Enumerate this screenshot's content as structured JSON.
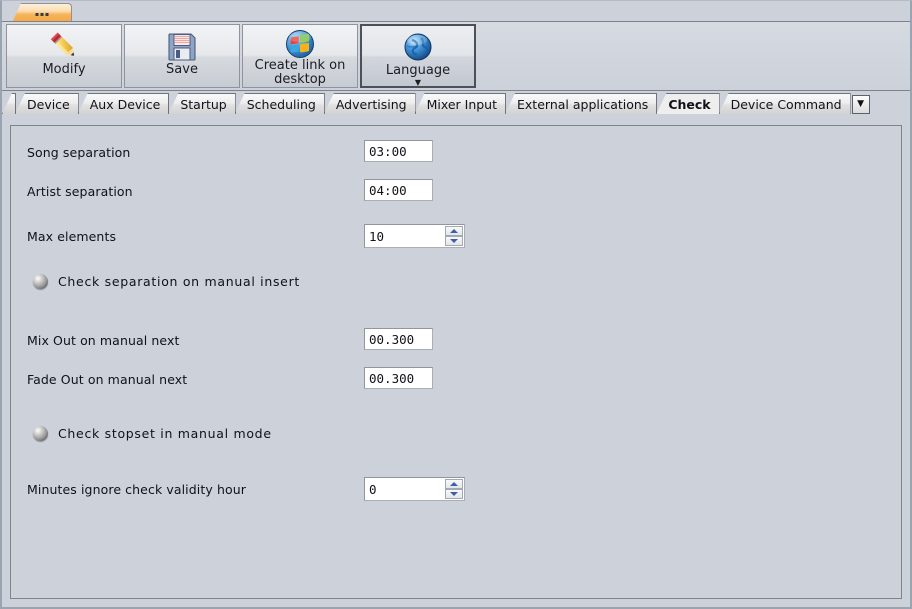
{
  "window": {
    "folder_tab": {
      "name": "overflow-dots",
      "label": "..."
    }
  },
  "toolbar": {
    "buttons": [
      {
        "id": "modify",
        "label": "Modify",
        "icon": "pencil-icon",
        "selected": false,
        "has_caret": false
      },
      {
        "id": "save",
        "label": "Save",
        "icon": "floppy-disk-icon",
        "selected": false,
        "has_caret": false
      },
      {
        "id": "shortcut",
        "label": "Create link on desktop",
        "icon": "windows-logo-icon",
        "selected": false,
        "has_caret": false
      },
      {
        "id": "language",
        "label": "Language",
        "icon": "globe-icon",
        "selected": true,
        "has_caret": true,
        "caret": "▼"
      }
    ]
  },
  "tabs": {
    "items": [
      {
        "label": "",
        "active": false,
        "clipped": true
      },
      {
        "label": "Device",
        "active": false
      },
      {
        "label": "Aux Device",
        "active": false
      },
      {
        "label": "Startup",
        "active": false
      },
      {
        "label": "Scheduling",
        "active": false
      },
      {
        "label": "Advertising",
        "active": false
      },
      {
        "label": "Mixer Input",
        "active": false
      },
      {
        "label": "External applications",
        "active": false
      },
      {
        "label": "Check",
        "active": true
      },
      {
        "label": "Device Command",
        "active": false
      }
    ],
    "overflow_glyph": "▼"
  },
  "check_panel": {
    "fields": [
      {
        "id": "song_separation",
        "label": "Song separation",
        "value": "03:00",
        "type": "text"
      },
      {
        "id": "artist_separation",
        "label": "Artist separation",
        "value": "04:00",
        "type": "text"
      },
      {
        "id": "max_elements",
        "label": "Max elements",
        "value": "10",
        "type": "spinner"
      },
      {
        "id": "mix_out",
        "label": "Mix Out on manual next",
        "value": "00.300",
        "type": "text"
      },
      {
        "id": "fade_out",
        "label": "Fade Out on manual next",
        "value": "00.300",
        "type": "text"
      },
      {
        "id": "minutes_ignore",
        "label": "Minutes ignore check validity hour",
        "value": "0",
        "type": "spinner"
      }
    ],
    "toggles": [
      {
        "id": "check_separation_manual_insert",
        "label": "Check separation on manual insert",
        "state": "off"
      },
      {
        "id": "check_stopset_manual_mode",
        "label": "Check stopset in manual mode",
        "state": "off"
      }
    ]
  },
  "colors": {
    "window_bg": "#ccd1da",
    "toolbar_top": "#d6dae1",
    "tab_active_bg": "#eeeeee",
    "accent_orange": "#f5a63f",
    "spinner_arrow": "#3f5ea8",
    "border": "#7f838d"
  }
}
